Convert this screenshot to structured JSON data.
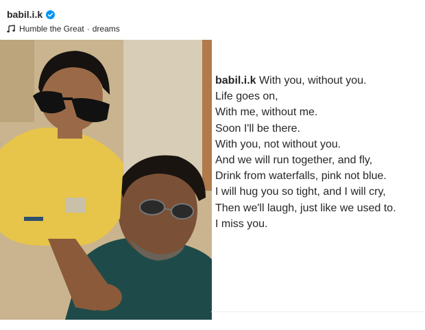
{
  "post": {
    "username": "babil.i.k",
    "verified": true,
    "audio": {
      "track": "Humble the Great",
      "separator": "·",
      "song": "dreams"
    },
    "image": {
      "alt_icon": "photo"
    },
    "caption": {
      "author": "babil.i.k",
      "lines": [
        "With you, without you.",
        "Life goes on,",
        "With me, without me.",
        "Soon I'll be there.",
        "With you, not without you.",
        "And we will run together, and fly,",
        "Drink from waterfalls, pink not blue.",
        "I will hug you so tight, and I will cry,",
        "Then we'll laugh, just like we used to.",
        "I miss you."
      ]
    }
  },
  "colors": {
    "text": "#262626",
    "verified_blue": "#0095f6",
    "divider": "#efefef"
  }
}
